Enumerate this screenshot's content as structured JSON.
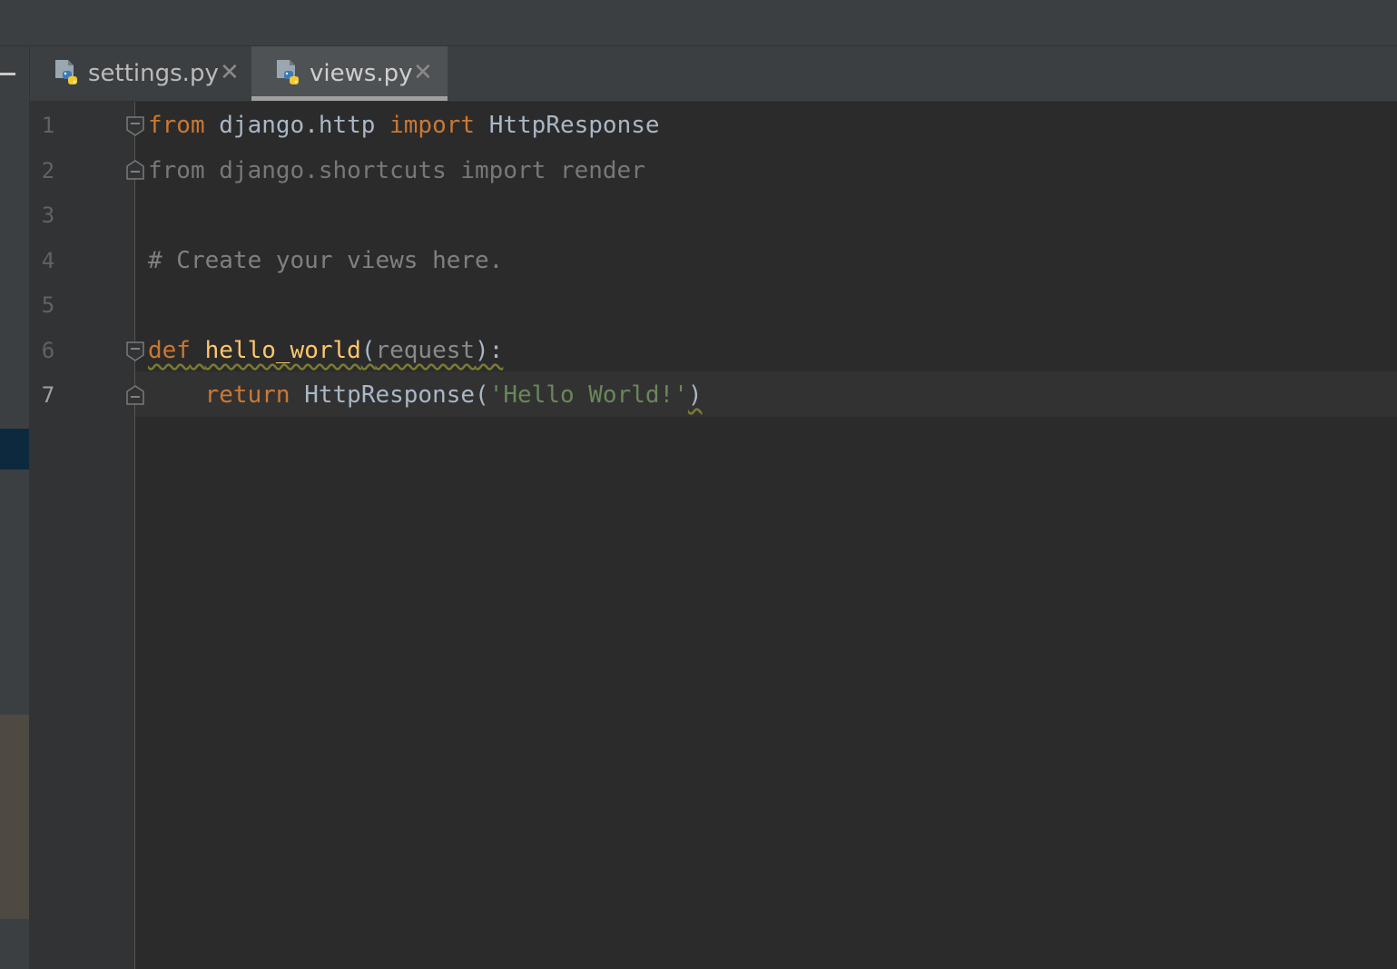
{
  "tabs": [
    {
      "label": "settings.py",
      "active": false,
      "icon": "python-file-icon"
    },
    {
      "label": "views.py",
      "active": true,
      "icon": "python-file-icon"
    }
  ],
  "editor": {
    "current_line": 7,
    "line_numbers": [
      "1",
      "2",
      "3",
      "4",
      "5",
      "6",
      "7"
    ],
    "lines": [
      {
        "kw1": "from",
        "mod": " django.http ",
        "kw2": "import",
        "name": " HttpResponse"
      },
      {
        "text": "from django.shortcuts import render",
        "unused": true
      },
      {
        "text": ""
      },
      {
        "comment": "# Create your views here."
      },
      {
        "text": ""
      },
      {
        "kw": "def",
        "sp": " ",
        "fn": "hello_world",
        "open": "(",
        "param": "request",
        "close": "):"
      },
      {
        "indent": "    ",
        "kw": "return",
        "call": " HttpResponse(",
        "str": "'Hello World!'",
        "close": ")"
      }
    ]
  },
  "colors": {
    "background": "#2b2b2b",
    "keyword": "#cc7832",
    "string": "#6a8759",
    "function": "#ffc66d",
    "comment": "#808080",
    "identifier": "#a9b7c6"
  }
}
